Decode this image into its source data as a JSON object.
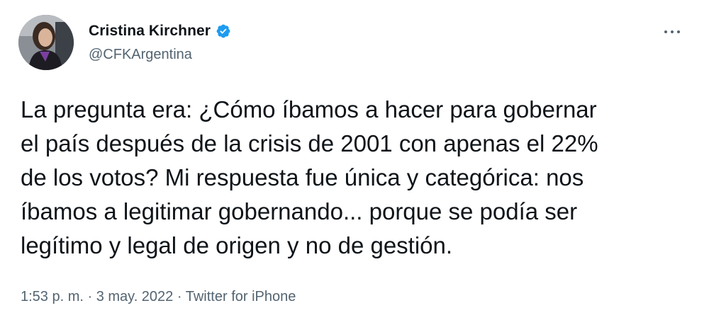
{
  "author": {
    "display_name": "Cristina Kirchner",
    "handle": "@CFKArgentina",
    "verified": true
  },
  "tweet": {
    "text": "La pregunta era: ¿Cómo íbamos a hacer para gobernar\nel país después de la crisis de 2001 con apenas el 22%\nde los votos? Mi respuesta fue única y categórica: nos\níbamos a legitimar gobernando... porque se podía ser\nlegítimo y legal de origen y no de gestión."
  },
  "meta": {
    "time": "1:53 p. m.",
    "separator_1": " · ",
    "date": "3 may. 2022",
    "separator_2": " · ",
    "source": "Twitter for iPhone"
  },
  "icons": {
    "verified": "verified-badge-icon",
    "more": "more-options-icon"
  },
  "colors": {
    "primary_text": "#0f1419",
    "secondary_text": "#536471",
    "verified_blue": "#1d9bf0",
    "background": "#ffffff"
  }
}
